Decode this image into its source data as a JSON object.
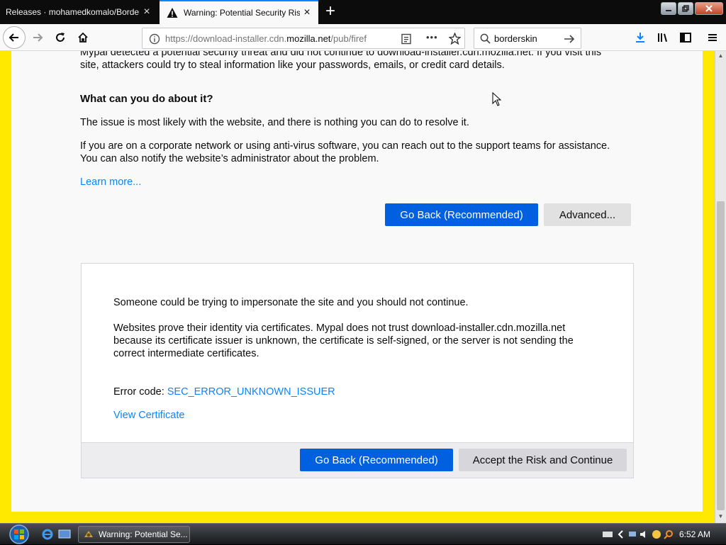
{
  "browser": {
    "tabs": [
      {
        "title": "Releases · mohamedkomalo/BorderSkin",
        "active": false
      },
      {
        "title": "Warning: Potential Security Risk Ahead",
        "active": true
      }
    ],
    "new_tab_symbol": "+",
    "close_symbol": "×",
    "window_controls": [
      "minimize",
      "restore",
      "close"
    ],
    "url": "https://download-installer.cdn.mozilla.net/pub/firefox",
    "url_host": "download-installer.cdn.",
    "url_domain": "mozilla.net",
    "url_path": "/pub/firef",
    "url_prefix": "https://",
    "page_actions_symbol": "•••",
    "search_value": "borderskin",
    "colors": {
      "accent": "#0a84ff",
      "frame_border": "#ffe900",
      "primary_button": "#0060df"
    }
  },
  "page": {
    "intro_line1": "Mypal detected a potential security threat and did not continue to download-installer.cdn.mozilla.net. If you visit this",
    "intro_line2": "site, attackers could try to steal information like your passwords, emails, or credit card details.",
    "what_heading": "What can you do about it?",
    "issue_text": "The issue is most likely with the website, and there is nothing you can do to resolve it.",
    "corporate_line1": "If you are on a corporate network or using anti-virus software, you can reach out to the support teams for assistance.",
    "corporate_line2": "You can also notify the website’s administrator about the problem.",
    "learn_more": "Learn more...",
    "go_back_label": "Go Back (Recommended)",
    "advanced_label": "Advanced...",
    "advanced_panel": {
      "impersonate_text": "Someone could be trying to impersonate the site and you should not continue.",
      "cert_line1": "Websites prove their identity via certificates. Mypal does not trust download-installer.cdn.mozilla.net",
      "cert_line2": "because its certificate issuer is unknown, the certificate is self-signed, or the server is not sending the",
      "cert_line3": "correct intermediate certificates.",
      "error_code_label": "Error code: ",
      "error_code": "SEC_ERROR_UNKNOWN_ISSUER",
      "view_certificate": "View Certificate",
      "go_back_label": "Go Back (Recommended)",
      "accept_label": "Accept the Risk and Continue"
    }
  },
  "taskbar": {
    "task_title": "Warning: Potential Se...",
    "clock": "6:52 AM"
  }
}
